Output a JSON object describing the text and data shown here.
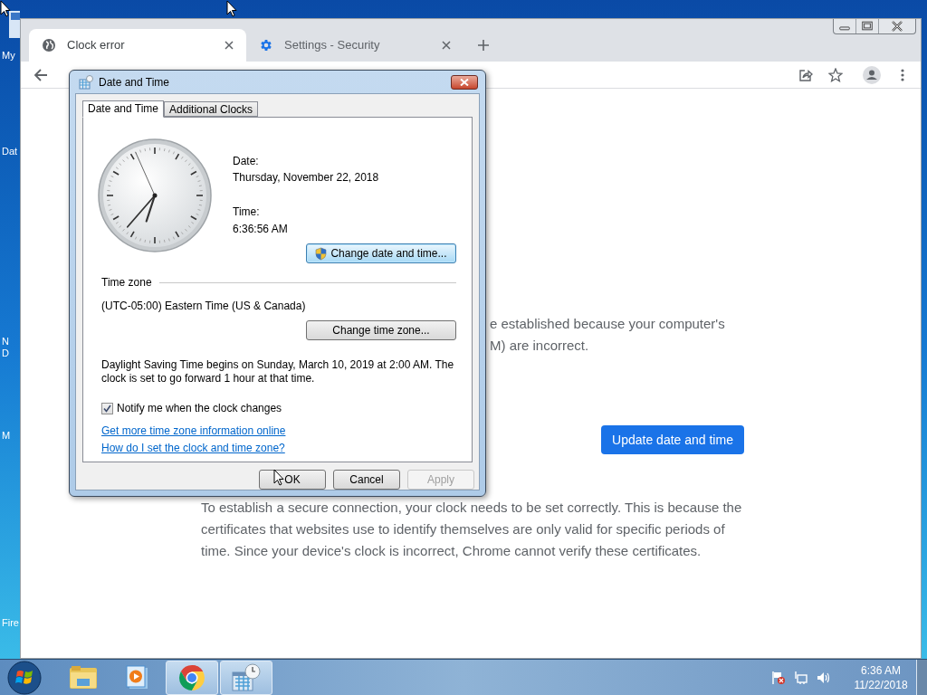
{
  "desktop_icons": [
    {
      "label": "My"
    },
    {
      "label": "Dat"
    },
    {
      "label": "N"
    },
    {
      "label": "D"
    },
    {
      "label": "M"
    },
    {
      "label": "Fire"
    }
  ],
  "browser": {
    "tabs": [
      {
        "label": "Clock error",
        "kind": "globe",
        "selected": true
      },
      {
        "label": "Settings - Security",
        "kind": "gear",
        "selected": false
      }
    ],
    "content": {
      "fragment_lines": [
        "e established because your computer's",
        "M) are incorrect."
      ],
      "button": "Update date and time",
      "paragraph": "To establish a secure connection, your clock needs to be set correctly. This is because the certificates that websites use to identify themselves are only valid for specific periods of time. Since your device's clock is incorrect, Chrome cannot verify these certificates."
    }
  },
  "dialog": {
    "title": "Date and Time",
    "tabs": [
      {
        "label": "Date and Time",
        "selected": true
      },
      {
        "label": "Additional Clocks",
        "selected": false
      }
    ],
    "date_label": "Date:",
    "date": "Thursday, November 22, 2018",
    "time_label": "Time:",
    "time": "6:36:56 AM",
    "change_date_button": {
      "label": "Change date and time...",
      "highlighted": true
    },
    "time_zone_heading": "Time zone",
    "time_zone": "(UTC-05:00) Eastern Time (US & Canada)",
    "change_zone_button": {
      "label": "Change time zone...",
      "highlighted": false
    },
    "dst_text": "Daylight Saving Time begins on Sunday, March 10, 2019 at 2:00 AM. The clock is set to go forward 1 hour at that time.",
    "notify": {
      "label": "Notify me when the clock changes",
      "checked": true
    },
    "links": [
      "Get more time zone information online",
      "How do I set the clock and time zone?"
    ],
    "buttons": [
      {
        "label": "OK",
        "disabled": false
      },
      {
        "label": "Cancel",
        "disabled": false
      },
      {
        "label": "Apply",
        "disabled": true
      }
    ]
  },
  "taskbar": {
    "items": [
      {
        "kind": "explorer",
        "active": false
      },
      {
        "kind": "media",
        "active": false
      },
      {
        "kind": "chrome",
        "active": true
      },
      {
        "kind": "calendar",
        "active": true
      }
    ],
    "clock_time": "6:36 AM",
    "clock_date": "11/22/2018"
  }
}
